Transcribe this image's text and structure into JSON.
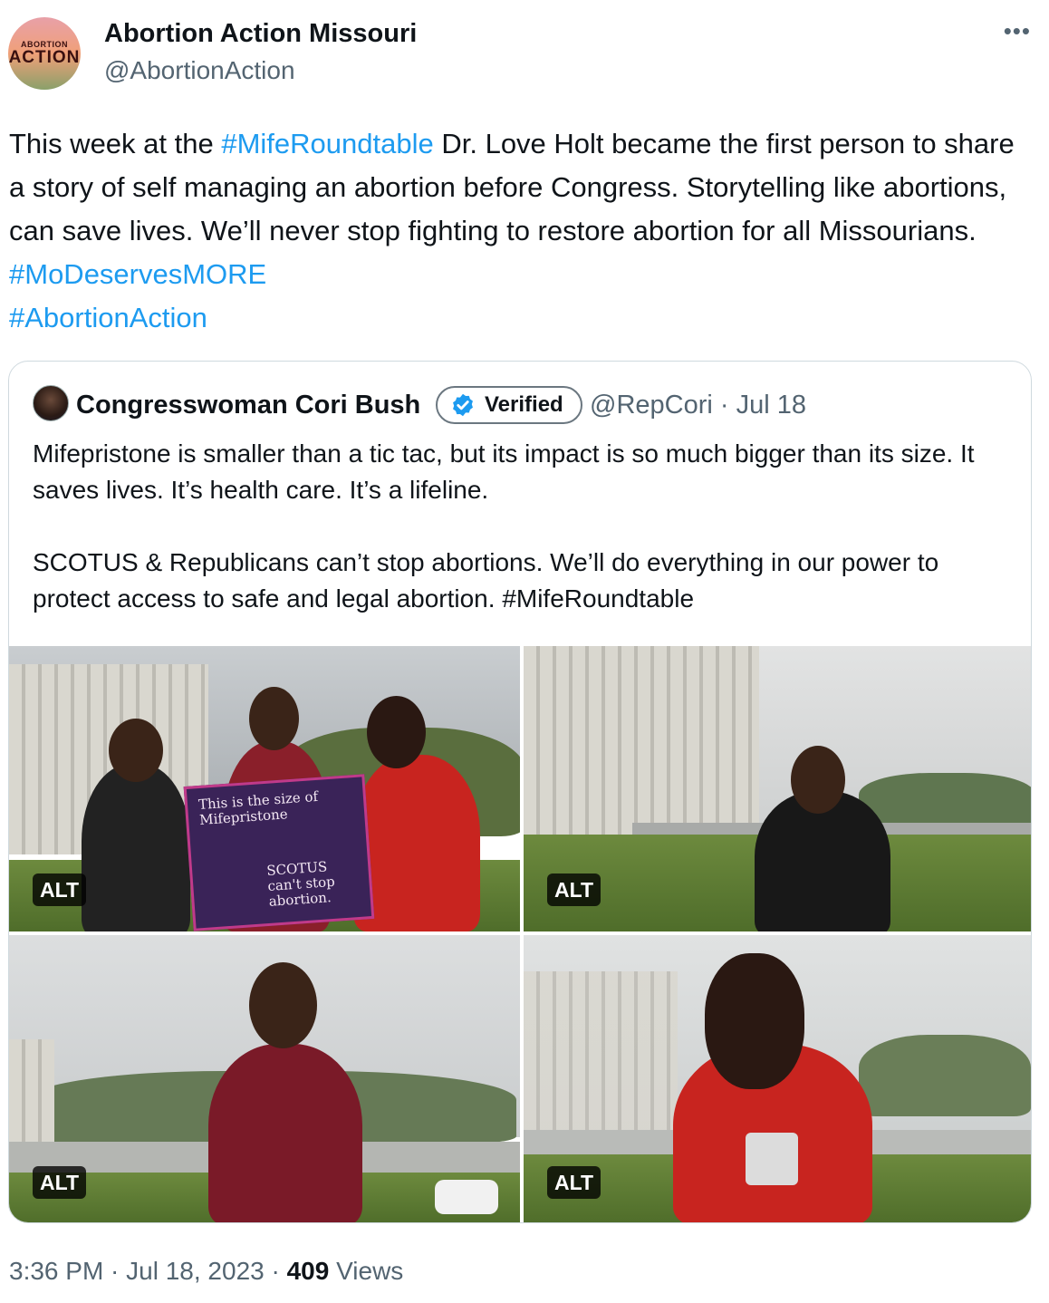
{
  "author": {
    "display_name": "Abortion Action Missouri",
    "handle": "@AbortionAction",
    "avatar_text_line1": "ABORTION",
    "avatar_text_line2": "ACTION"
  },
  "more_icon": "ellipsis-icon",
  "tweet": {
    "seg1": "This week at the ",
    "tag1": "#MifeRoundtable",
    "seg2": " Dr. Love Holt became the first person to share a story of self managing an abortion before Congress. Storytelling like abortions, can save lives. We’ll never stop fighting to restore abortion for all Missourians. ",
    "tag2": "#MoDeservesMORE",
    "tag3": "#AbortionAction"
  },
  "quote": {
    "name": "Congresswoman Cori Bush",
    "verified_label": "Verified",
    "handle_date": "@RepCori · Jul 18",
    "para1": "Mifepristone is smaller than a tic tac, but its impact is so much bigger than its size. It saves lives. It’s health care. It’s a lifeline.",
    "para2": "SCOTUS & Republicans can’t stop abortions. We’ll do everything in our power to protect access to safe and legal abortion. #MifeRoundtable",
    "photos": [
      {
        "alt_label": "ALT",
        "sign_line1": "This is the size of Mifepristone",
        "sign_line2": "SCOTUS can't stop abortion."
      },
      {
        "alt_label": "ALT"
      },
      {
        "alt_label": "ALT"
      },
      {
        "alt_label": "ALT"
      }
    ]
  },
  "footer": {
    "time_date": "3:36 PM · Jul 18, 2023 · ",
    "views_count": "409",
    "views_label": " Views"
  },
  "colors": {
    "link": "#1d9bf0",
    "secondary_text": "#536471",
    "border": "#cfd9de",
    "verified_blue": "#1d9bf0"
  }
}
